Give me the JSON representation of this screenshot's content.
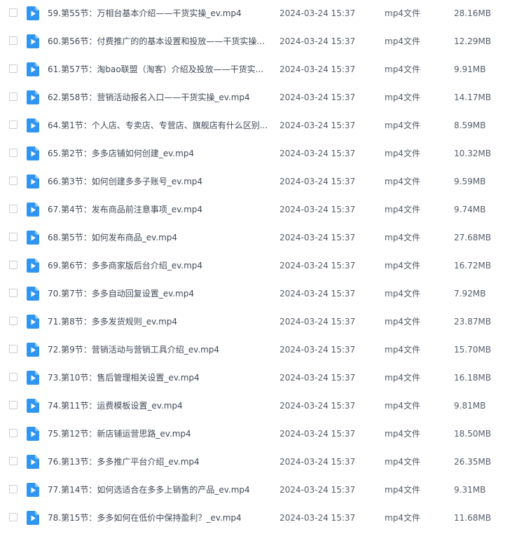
{
  "icon": "video-file-icon",
  "icon_color": "#2f95f0",
  "files": [
    {
      "name": "59.第55节：万相台基本介绍——干货实操_ev.mp4",
      "date": "2024-03-24 15:37",
      "type": "mp4文件",
      "size": "28.16MB"
    },
    {
      "name": "60.第56节：付费推广的的基本设置和投放——干货实操...",
      "date": "2024-03-24 15:37",
      "type": "mp4文件",
      "size": "12.29MB"
    },
    {
      "name": "61.第57节：淘bao联盟（淘客）介绍及投放——干货实...",
      "date": "2024-03-24 15:37",
      "type": "mp4文件",
      "size": "9.91MB"
    },
    {
      "name": "62.第58节：营销活动报名入口——干货实操_ev.mp4",
      "date": "2024-03-24 15:37",
      "type": "mp4文件",
      "size": "14.17MB"
    },
    {
      "name": "64.第1节：个人店、专卖店、专营店、旗舰店有什么区别...",
      "date": "2024-03-24 15:37",
      "type": "mp4文件",
      "size": "8.59MB"
    },
    {
      "name": "65.第2节：多多店铺如何创建_ev.mp4",
      "date": "2024-03-24 15:37",
      "type": "mp4文件",
      "size": "10.32MB"
    },
    {
      "name": "66.第3节：如何创建多多子账号_ev.mp4",
      "date": "2024-03-24 15:37",
      "type": "mp4文件",
      "size": "9.59MB"
    },
    {
      "name": "67.第4节：发布商品前注意事项_ev.mp4",
      "date": "2024-03-24 15:37",
      "type": "mp4文件",
      "size": "9.74MB"
    },
    {
      "name": "68.第5节：如何发布商品_ev.mp4",
      "date": "2024-03-24 15:37",
      "type": "mp4文件",
      "size": "27.68MB"
    },
    {
      "name": "69.第6节：多多商家版后台介绍_ev.mp4",
      "date": "2024-03-24 15:37",
      "type": "mp4文件",
      "size": "16.72MB"
    },
    {
      "name": "70.第7节：多多自动回复设置_ev.mp4",
      "date": "2024-03-24 15:37",
      "type": "mp4文件",
      "size": "7.92MB"
    },
    {
      "name": "71.第8节：多多发货规则_ev.mp4",
      "date": "2024-03-24 15:37",
      "type": "mp4文件",
      "size": "23.87MB"
    },
    {
      "name": "72.第9节：营销活动与营销工具介绍_ev.mp4",
      "date": "2024-03-24 15:37",
      "type": "mp4文件",
      "size": "15.70MB"
    },
    {
      "name": "73.第10节：售后管理相关设置_ev.mp4",
      "date": "2024-03-24 15:37",
      "type": "mp4文件",
      "size": "16.18MB"
    },
    {
      "name": "74.第11节：运费模板设置_ev.mp4",
      "date": "2024-03-24 15:37",
      "type": "mp4文件",
      "size": "9.81MB"
    },
    {
      "name": "75.第12节：新店铺运营思路_ev.mp4",
      "date": "2024-03-24 15:37",
      "type": "mp4文件",
      "size": "18.50MB"
    },
    {
      "name": "76.第13节：多多推广平台介绍_ev.mp4",
      "date": "2024-03-24 15:37",
      "type": "mp4文件",
      "size": "26.35MB"
    },
    {
      "name": "77.第14节：如何选适合在多多上销售的产品_ev.mp4",
      "date": "2024-03-24 15:37",
      "type": "mp4文件",
      "size": "9.31MB"
    },
    {
      "name": "78.第15节：多多如何在低价中保持盈利？_ev.mp4",
      "date": "2024-03-24 15:37",
      "type": "mp4文件",
      "size": "11.68MB"
    }
  ]
}
